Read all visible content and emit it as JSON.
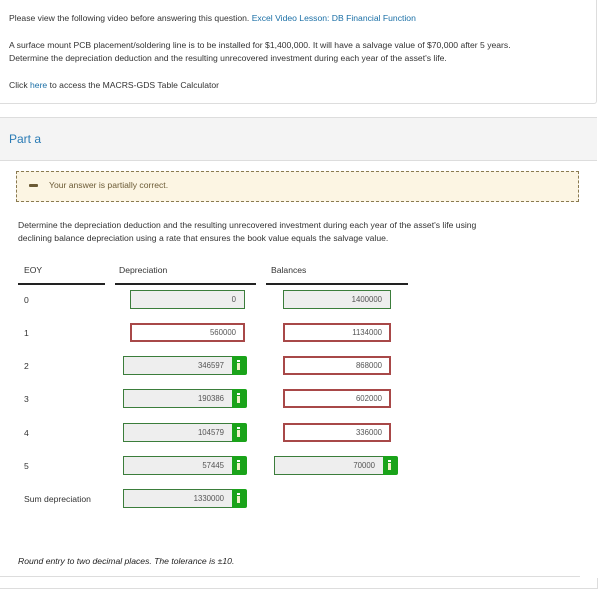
{
  "intro": {
    "video_prompt": "Please view the following video before answering this question.",
    "video_link": "Excel Video Lesson: DB Financial Function",
    "problem_line1": "A surface mount PCB placement/soldering line is to be installed for $1,400,000. It will have a salvage value of $70,000 after 5 years.",
    "problem_line2": "Determine the depreciation deduction and the resulting unrecovered investment during each year of the asset's life.",
    "calc_prefix": "Click",
    "calc_link": "here",
    "calc_suffix": "to access the MACRS-GDS Table Calculator"
  },
  "part": {
    "title": "Part a",
    "alert": "Your answer is partially correct.",
    "question_line1": "Determine the depreciation deduction and the resulting unrecovered investment during each year of the asset's life using",
    "question_line2": "declining balance depreciation using a rate that ensures the book value equals the salvage value."
  },
  "table": {
    "headers": {
      "eoy": "EOY",
      "depreciation": "Depreciation",
      "balances": "Balances"
    },
    "rows": [
      {
        "eoy": "0",
        "depreciation": "0",
        "dep_status": "given",
        "balance": "1400000",
        "bal_status": "given"
      },
      {
        "eoy": "1",
        "depreciation": "560000",
        "dep_status": "incorrect",
        "balance": "1134000",
        "bal_status": "incorrect"
      },
      {
        "eoy": "2",
        "depreciation": "346597",
        "dep_status": "correct",
        "balance": "868000",
        "bal_status": "incorrect"
      },
      {
        "eoy": "3",
        "depreciation": "190386",
        "dep_status": "correct",
        "balance": "602000",
        "bal_status": "incorrect"
      },
      {
        "eoy": "4",
        "depreciation": "104579",
        "dep_status": "correct",
        "balance": "336000",
        "bal_status": "incorrect"
      },
      {
        "eoy": "5",
        "depreciation": "57445",
        "dep_status": "correct",
        "balance": "70000",
        "bal_status": "correct"
      }
    ],
    "sum_label": "Sum depreciation",
    "sum_value": "1330000",
    "sum_status": "correct"
  },
  "note": "Round entry to two decimal places. The tolerance is ±10.",
  "colors": {
    "correct": "#1aa31a",
    "incorrect": "#a84848",
    "link": "#1a6fa6",
    "alert_bg": "#fcf5e3"
  }
}
